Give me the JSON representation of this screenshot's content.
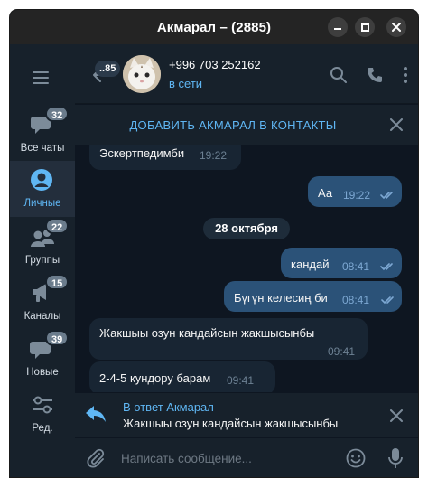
{
  "window": {
    "title": "Акмарал – (2885)",
    "controls": [
      "minimize-icon",
      "maximize-icon",
      "close-icon"
    ]
  },
  "sidebar": {
    "folders": [
      {
        "label": "Все чаты",
        "badge": "32",
        "icon": "chats-icon",
        "active": false
      },
      {
        "label": "Личные",
        "badge": "",
        "icon": "person-icon",
        "active": true
      },
      {
        "label": "Группы",
        "badge": "22",
        "icon": "group-icon",
        "active": false
      },
      {
        "label": "Каналы",
        "badge": "15",
        "icon": "channel-icon",
        "active": false
      },
      {
        "label": "Новые",
        "badge": "39",
        "icon": "new-chat-icon",
        "active": false
      },
      {
        "label": "Ред.",
        "badge": "",
        "icon": "filters-icon",
        "active": false
      }
    ]
  },
  "header": {
    "back_badge": "..85",
    "peer_name": "+996 703 252162",
    "peer_status": "в сети"
  },
  "add_contact": {
    "label": "ДОБАВИТЬ АКМАРАЛ В КОНТАКТЫ"
  },
  "messages": [
    {
      "dir": "in",
      "text": "Эскертпедимби",
      "time": "19:22"
    },
    {
      "dir": "out",
      "text": "Аа",
      "time": "19:22",
      "read": true
    },
    {
      "dir": "date",
      "text": "28 октября"
    },
    {
      "dir": "out",
      "text": "кандай",
      "time": "08:41",
      "read": true
    },
    {
      "dir": "out",
      "text": "Бүгүн келесиң би",
      "time": "08:41",
      "read": true
    },
    {
      "dir": "in",
      "text": "Жакшыы озун кандайсын жакшысынбы",
      "time": "09:41"
    },
    {
      "dir": "in",
      "text": "2-4-5 кундору барам",
      "time": "09:41"
    }
  ],
  "reply": {
    "title": "В ответ Акмарал",
    "text": "Жакшыы озун кандайсын жакшысынбы"
  },
  "composer": {
    "placeholder": "Написать сообщение..."
  },
  "colors": {
    "accent": "#5fb6f3",
    "outgoing_bubble": "#2b5278",
    "incoming_bubble": "#182533",
    "chat_background": "#0e1621",
    "panel": "#17212b"
  }
}
